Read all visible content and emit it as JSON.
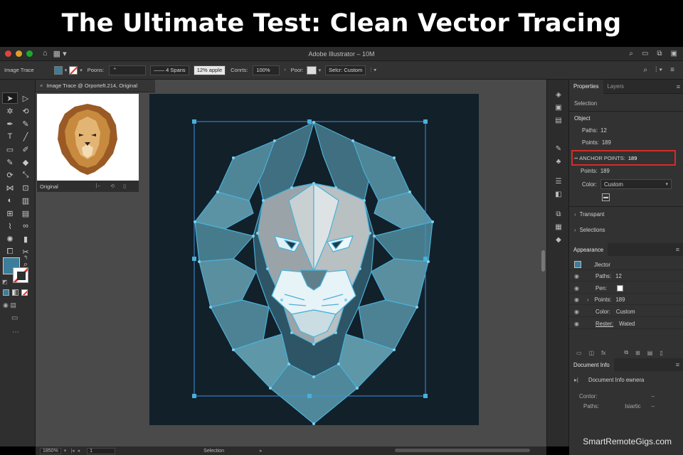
{
  "banner": {
    "title": "The Ultimate Test: Clean Vector Tracing"
  },
  "window": {
    "title": "Adobe Illustrator – 10M"
  },
  "control_bar": {
    "panel_label": "Image Trace",
    "points_label": "Poons:",
    "stroke_dd": "—— 4 Spans",
    "fill_dd": "12% apple",
    "contrast_label": "Conrts:",
    "contrast_value": "100%",
    "pour_label": "Poor:",
    "select_label": "Selcr: Custom"
  },
  "document": {
    "tab_title": "Image Trace @ Orporteft.214, Original",
    "thumb_label": "Original"
  },
  "status_bar": {
    "zoom": "1850%",
    "page": "1",
    "mode": "Selection"
  },
  "properties": {
    "tab_properties": "Properties",
    "tab_layers": "Layers",
    "selection": "Selection",
    "object": "Object",
    "paths_label": "Paths:",
    "paths_value": "12",
    "points_label": "Points:",
    "points_value": "189",
    "anchor_label": "ANCHOR POINTS:",
    "anchor_value": "189",
    "points2_label": "Points:",
    "points2_value": "189",
    "color_label": "Color:",
    "color_value": "Custom",
    "transparent": "Transpant",
    "selections": "Selections"
  },
  "appearance": {
    "title": "Appearance",
    "vector": "Jlector",
    "paths_label": "Paths:",
    "paths_value": "12",
    "pen_label": "Pen:",
    "points_label": "Points:",
    "points_value": "189",
    "color_label": "Color:",
    "color_value": "Custom",
    "raster_label": "Rester:",
    "raster_value": "Wated"
  },
  "document_info": {
    "title": "Document Info",
    "line": "Document Info ewnera",
    "contour_label": "Contor:",
    "contour_value": "–",
    "paths_label": "Paths:",
    "paths_value": "Isiartic",
    "dash": "–"
  },
  "watermark": "SmartRemoteGigs.com",
  "colors": {
    "accent": "#3c7d9a",
    "highlight": "#d52c28",
    "artboard": "#12202a",
    "trace_line": "#4ab0d8"
  },
  "icons": [
    "home-icon",
    "workspace-icon",
    "search-icon",
    "selection-tool-icon",
    "pen-tool-icon",
    "type-tool-icon",
    "hand-tool-icon",
    "zoom-tool-icon",
    "eye-icon",
    "panel-menu-icon"
  ]
}
